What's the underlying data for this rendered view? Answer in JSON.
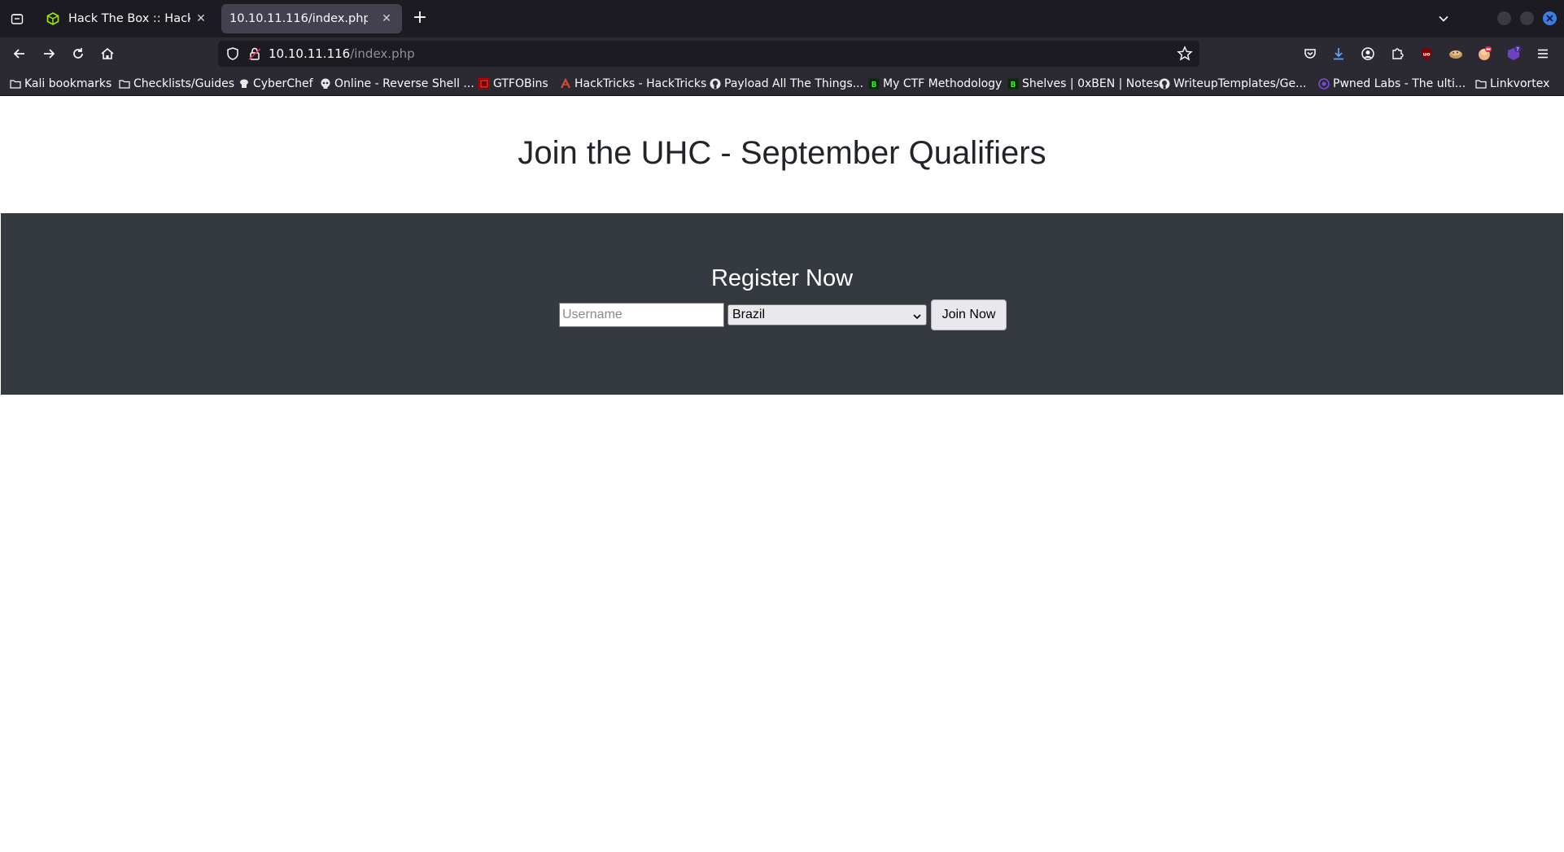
{
  "browser": {
    "tabs": [
      {
        "title": "Hack The Box :: Hack The",
        "active": false,
        "favicon": "hackthebox-cube-icon"
      },
      {
        "title": "10.10.11.116/index.php",
        "active": true,
        "favicon": ""
      }
    ],
    "url": {
      "host": "10.10.11.116",
      "path": "/index.php"
    },
    "bookmarks": [
      {
        "label": "Kali bookmarks",
        "icon": "folder-icon"
      },
      {
        "label": "Checklists/Guides",
        "icon": "folder-icon"
      },
      {
        "label": "CyberChef",
        "icon": "cyberchef-icon"
      },
      {
        "label": "Online - Reverse Shell ...",
        "icon": "skull-icon"
      },
      {
        "label": "GTFOBins",
        "icon": "gtfobins-icon"
      },
      {
        "label": "HackTricks - HackTricks",
        "icon": "hacktricks-icon"
      },
      {
        "label": "Payload All The Things...",
        "icon": "github-icon"
      },
      {
        "label": "My CTF Methodology",
        "icon": "bookstack-icon"
      },
      {
        "label": "Shelves | 0xBEN | Notes",
        "icon": "bookstack-icon"
      },
      {
        "label": "WriteupTemplates/Ge...",
        "icon": "github-icon"
      },
      {
        "label": "Pwned Labs - The ulti...",
        "icon": "pwnedlabs-icon"
      },
      {
        "label": "Linkvortex",
        "icon": "folder-icon"
      }
    ],
    "extension_badge": "7"
  },
  "page": {
    "title": "Join the UHC - September Qualifiers",
    "register": {
      "heading": "Register Now",
      "username_placeholder": "Username",
      "country_selected": "Brazil",
      "submit_label": "Join Now"
    }
  }
}
